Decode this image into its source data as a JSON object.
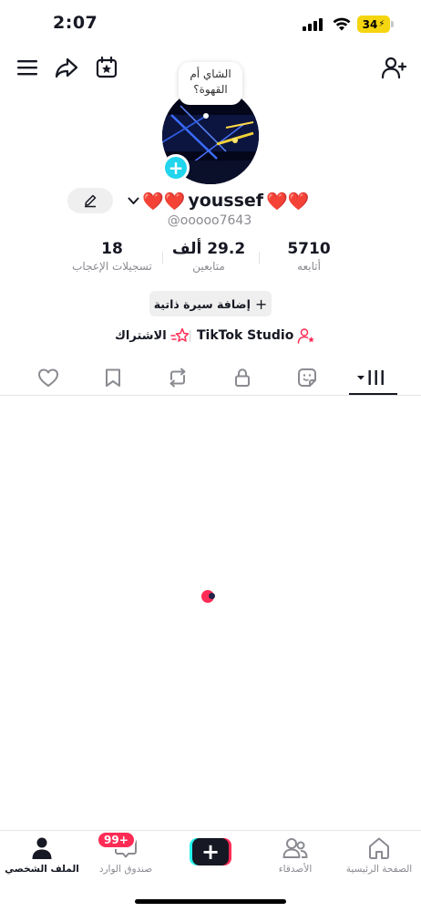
{
  "status_bar": {
    "time": "2:07",
    "battery": "34"
  },
  "profile": {
    "note_text": "الشاي أم القهوة؟",
    "display_name": "youssef",
    "name_emoji_left": "❤️❤️",
    "name_emoji_right": "❤️❤️",
    "username": "@ooooo7643",
    "avatar_plus": "+"
  },
  "stats": [
    {
      "value": "18",
      "label": "تسجيلات الإعجاب"
    },
    {
      "value": "29.2 ألف",
      "label": "متابعين"
    },
    {
      "value": "5710",
      "label": "أتابعه"
    }
  ],
  "bio_button": {
    "plus": "+",
    "label": "إضافة سيرة ذاتية"
  },
  "links": {
    "studio": "TikTok Studio",
    "subscribe": "الاشتراك"
  },
  "bottom_nav": {
    "profile": "الملف الشخصي",
    "inbox": "صندوق الوارد",
    "inbox_badge": "99+",
    "create": "+",
    "friends": "الأصدقاء",
    "home": "الصفحة الرئيسية"
  },
  "colors": {
    "accent_red": "#fe2c55",
    "accent_cyan": "#20d5ec",
    "text_primary": "#161823",
    "text_secondary": "#8a8b91"
  },
  "icons": {
    "top_left": [
      "menu-icon",
      "share-icon",
      "calendar-star-icon"
    ],
    "top_right": "add-user-icon",
    "tabs": [
      "heart-icon",
      "bookmark-icon",
      "repost-icon",
      "lock-icon",
      "sticker-icon",
      "grid-icon"
    ]
  }
}
